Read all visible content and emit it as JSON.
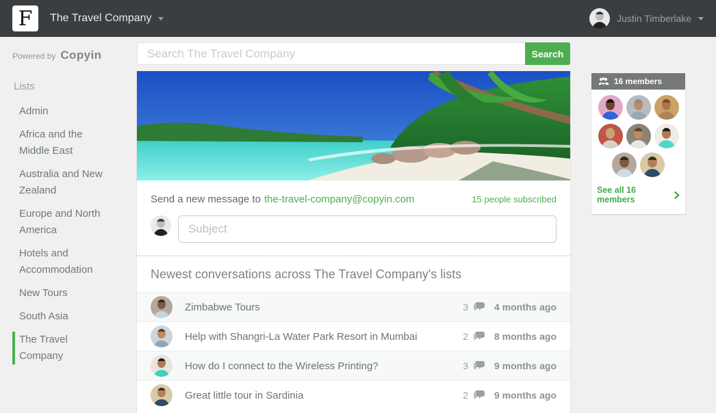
{
  "header": {
    "logo_letter": "F",
    "workspace_name": "The Travel Company",
    "user_name": "Justin Timberlake"
  },
  "sidebar": {
    "powered_by": "Powered by",
    "brand": "Copyin",
    "section_title": "Lists",
    "items": [
      {
        "label": "Admin",
        "active": false
      },
      {
        "label": "Africa and the Middle East",
        "active": false
      },
      {
        "label": "Australia and New Zealand",
        "active": false
      },
      {
        "label": "Europe and North America",
        "active": false
      },
      {
        "label": "Hotels and Accommodation",
        "active": false
      },
      {
        "label": "New Tours",
        "active": false
      },
      {
        "label": "South Asia",
        "active": false
      },
      {
        "label": "The Travel Company",
        "active": true
      }
    ]
  },
  "search": {
    "placeholder": "Search The Travel Company",
    "button_label": "Search"
  },
  "compose": {
    "prompt": "Send a new message to",
    "email": "the-travel-company@copyin.com",
    "subscribed": "15 people subscribed",
    "subject_placeholder": "Subject"
  },
  "conversations": {
    "heading": "Newest conversations across The Travel Company's lists",
    "rows": [
      {
        "title": "Zimbabwe Tours",
        "comments": "3",
        "time": "4 months ago"
      },
      {
        "title": "Help with Shangri-La Water Park Resort in Mumbai",
        "comments": "2",
        "time": "8 months ago"
      },
      {
        "title": "How do I connect to the Wireless Printing?",
        "comments": "3",
        "time": "9 months ago"
      },
      {
        "title": "Great little tour in Sardinia",
        "comments": "2",
        "time": "9 months ago"
      }
    ]
  },
  "members": {
    "count_label": "16 members",
    "see_all_label": "See all 16 members"
  },
  "icons": {
    "workspace_caret": "caret-down",
    "user_caret": "caret-down",
    "members_icon": "group-silhouette",
    "comments_icon": "speech-bubbles",
    "see_all_chevron": "chevron-right"
  },
  "colors": {
    "accent_green": "#4cae50",
    "topbar_bg": "#3a3e40",
    "members_header_bg": "#747879",
    "page_bg": "#f0f0f0"
  },
  "avatars": {
    "user": {
      "bg": "#e9e9e9",
      "hair": "#3c3c3c",
      "skin": "#bdbdbd",
      "shirt": "#222222"
    },
    "conversations": [
      {
        "bg": "#b5a79b",
        "hair": "#2e2620",
        "skin": "#7d5a42",
        "shirt": "#c3d6e2"
      },
      {
        "bg": "#cfd4d8",
        "hair": "#4a3a2c",
        "skin": "#c18a5f",
        "shirt": "#8fa6b8"
      },
      {
        "bg": "#e8e4de",
        "hair": "#221a16",
        "skin": "#b07a50",
        "shirt": "#3ecfc0"
      },
      {
        "bg": "#d9c9a8",
        "hair": "#3a2d22",
        "skin": "#b3805a",
        "shirt": "#2d4a66"
      }
    ],
    "members": [
      {
        "bg": "#e2a8c6",
        "hair": "#1a120e",
        "skin": "#6b4430",
        "shirt": "#2f62dd"
      },
      {
        "bg": "#b8bcc0",
        "hair": "#8a8d90",
        "skin": "#c08a62",
        "shirt": "#9aa8b4"
      },
      {
        "bg": "#caa269",
        "hair": "#7a4a28",
        "skin": "#a87848",
        "shirt": "#b08455"
      },
      {
        "bg": "#c05548",
        "hair": "#c8a86a",
        "skin": "#caa275",
        "shirt": "#d8d0c8"
      },
      {
        "bg": "#8a8478",
        "hair": "#5a4632",
        "skin": "#c08a5c",
        "shirt": "#e8e6e2"
      },
      {
        "bg": "#efece7",
        "hair": "#241c18",
        "skin": "#b07a50",
        "shirt": "#4ed8c8"
      },
      {
        "bg": "#b5a79b",
        "hair": "#2e2620",
        "skin": "#7d5a42",
        "shirt": "#ccdce6"
      },
      {
        "bg": "#d9c9a8",
        "hair": "#3a2d22",
        "skin": "#b3805a",
        "shirt": "#2d4a66"
      }
    ]
  }
}
